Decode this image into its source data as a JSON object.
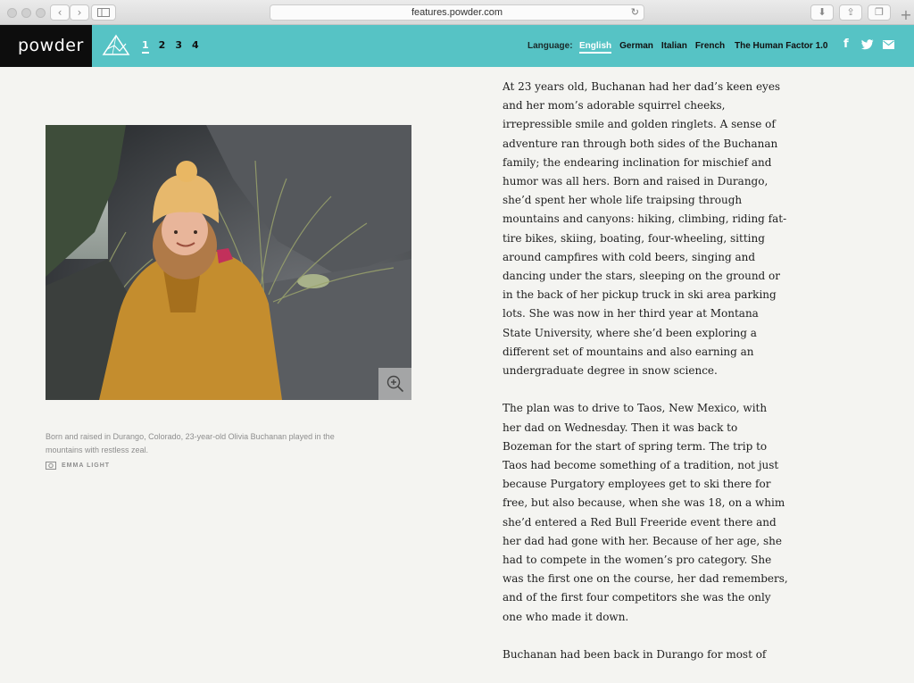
{
  "browser": {
    "url": "features.powder.com",
    "back_icon": "chevron-left-icon",
    "forward_icon": "chevron-right-icon"
  },
  "header": {
    "logo": "powder",
    "chapters": [
      "1",
      "2",
      "3",
      "4"
    ],
    "active_chapter": "1",
    "language_label": "Language:",
    "languages": [
      "English",
      "German",
      "Italian",
      "French"
    ],
    "active_language": "English",
    "series_link": "The Human Factor 1.0",
    "social_icons": [
      "facebook-icon",
      "twitter-icon",
      "email-icon"
    ]
  },
  "photo": {
    "caption": "Born and raised in Durango, Colorado, 23-year-old Olivia Buchanan played in the mountains with restless zeal.",
    "credit": "EMMA LIGHT"
  },
  "article": {
    "paragraphs": [
      "At 23 years old, Buchanan had her dad’s keen eyes and her mom’s adorable squirrel cheeks, irrepressible smile and golden ringlets. A sense of adventure ran through both sides of the Buchanan family; the endearing inclination for mischief and humor was all hers. Born and raised in Durango, she’d spent her whole life traipsing through mountains and canyons: hiking, climbing, riding fat-tire bikes, skiing, boating, four-wheeling, sitting around campfires with cold beers, singing and dancing under the stars, sleeping on the ground or in the back of her pickup truck in ski area parking lots. She was now in her third year at Montana State University, where she’d been exploring a different set of mountains and also earning an undergraduate degree in snow science.",
      "The plan was to drive to Taos, New Mexico, with her dad on Wednesday. Then it was back to Bozeman for the start of spring term. The trip to Taos had become something of a tradition, not just because Purgatory employees get to ski there for free, but also because, when she was 18, on a whim she’d entered a Red Bull Freeride event there and her dad had gone with her. Because of her age, she had to compete in the women’s pro category. She was the first one on the course, her dad remembers, and of the first four competitors she was the only one who made it down.",
      "Buchanan had been back in Durango for most of"
    ]
  }
}
